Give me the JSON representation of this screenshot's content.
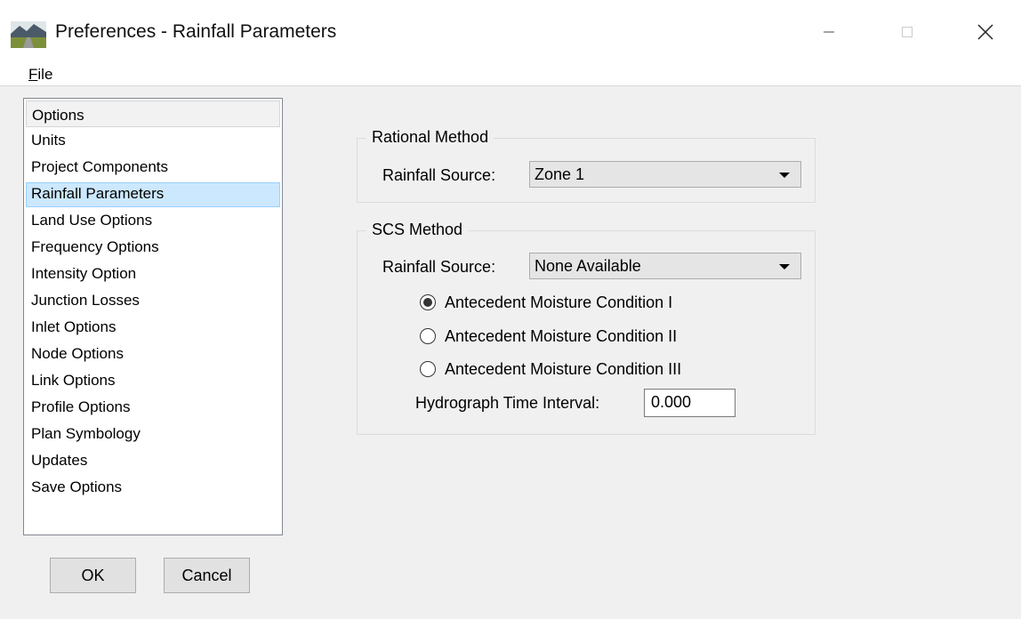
{
  "window": {
    "title": "Preferences - Rainfall Parameters",
    "icon": "app-landscape-icon"
  },
  "menu": {
    "file_mnemonic": "F",
    "file_rest": "ile"
  },
  "options": {
    "header": "Options",
    "items": [
      "Units",
      "Project Components",
      "Rainfall Parameters",
      "Land Use Options",
      "Frequency Options",
      "Intensity Option",
      "Junction Losses",
      "Inlet Options",
      "Node Options",
      "Link Options",
      "Profile Options",
      "Plan Symbology",
      "Updates",
      "Save Options"
    ],
    "selected": "Rainfall Parameters"
  },
  "buttons": {
    "ok": "OK",
    "cancel": "Cancel"
  },
  "rational": {
    "title": "Rational Method",
    "rainfall_source_label": "Rainfall Source:",
    "rainfall_source_value": "Zone 1"
  },
  "scs": {
    "title": "SCS Method",
    "rainfall_source_label": "Rainfall Source:",
    "rainfall_source_value": "None Available",
    "amc": [
      {
        "label": "Antecedent Moisture Condition I",
        "checked": true
      },
      {
        "label": "Antecedent Moisture Condition II",
        "checked": false
      },
      {
        "label": "Antecedent Moisture Condition III",
        "checked": false
      }
    ],
    "interval_label": "Hydrograph Time Interval:",
    "interval_value": "0.000"
  },
  "colors": {
    "selection_bg": "#cce8ff",
    "selection_border": "#99d1ff",
    "dialog_bg": "#f0f0f0"
  }
}
